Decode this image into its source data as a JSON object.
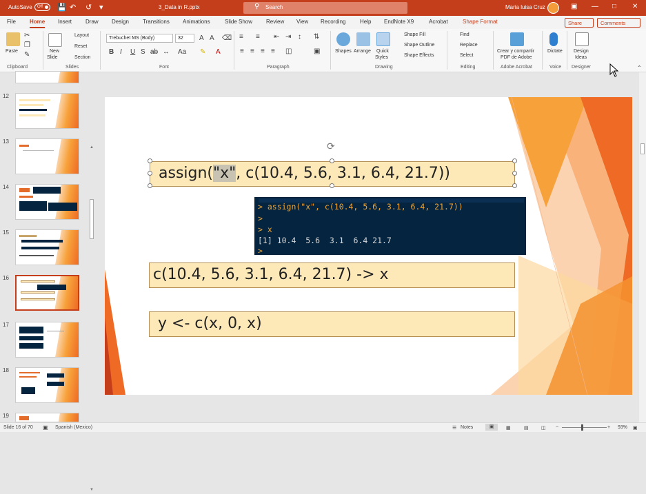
{
  "titlebar": {
    "autosave_label": "AutoSave",
    "autosave_state": "Off",
    "filename": "3_Data in R.pptx",
    "search_placeholder": "Search",
    "user_name": "Maria luisa Cruz"
  },
  "tabs": [
    "File",
    "Home",
    "Insert",
    "Draw",
    "Design",
    "Transitions",
    "Animations",
    "Slide Show",
    "Review",
    "View",
    "Recording",
    "Help",
    "EndNote X9",
    "Acrobat",
    "Shape Format"
  ],
  "active_tab": "Home",
  "share_label": "Share",
  "comments_label": "Comments",
  "ribbon": {
    "clipboard": {
      "paste": "Paste",
      "label": "Clipboard"
    },
    "slides": {
      "new_slide": "New",
      "new_slide2": "Slide",
      "layout": "Layout",
      "reset": "Reset",
      "section": "Section",
      "label": "Slides"
    },
    "font": {
      "font_name": "Trebuchet MS (Body)",
      "font_size": "32",
      "label": "Font"
    },
    "paragraph": {
      "label": "Paragraph"
    },
    "drawing": {
      "shapes": "Shapes",
      "arrange": "Arrange",
      "quick_styles": "Quick",
      "quick_styles2": "Styles",
      "shape_fill": "Shape Fill",
      "shape_outline": "Shape Outline",
      "shape_effects": "Shape Effects",
      "label": "Drawing"
    },
    "editing": {
      "find": "Find",
      "replace": "Replace",
      "select": "Select",
      "label": "Editing"
    },
    "acrobat": {
      "create": "Crear y compartir",
      "create2": "PDF de Adobe",
      "label": "Adobe Acrobat"
    },
    "voice": {
      "dictate": "Dictate",
      "label": "Voice"
    },
    "designer": {
      "design_ideas": "Design",
      "design_ideas2": "Ideas",
      "label": "Designer"
    }
  },
  "thumbnails": [
    {
      "num": "12"
    },
    {
      "num": "13"
    },
    {
      "num": "14"
    },
    {
      "num": "15"
    },
    {
      "num": "16"
    },
    {
      "num": "17"
    },
    {
      "num": "18"
    },
    {
      "num": "19"
    }
  ],
  "slide": {
    "box1_pre": "assign(",
    "box1_sel": "\"x\"",
    "box1_post": ", c(10.4, 5.6, 3.1, 6.4, 21.7))",
    "console_line1": "> assign(\"x\", c(10.4, 5.6, 3.1, 6.4, 21.7))",
    "console_line2": ">",
    "console_line3": "> x",
    "console_line4": "[1] 10.4  5.6  3.1  6.4 21.7",
    "console_line5": ">",
    "box2": "c(10.4, 5.6, 3.1, 6.4, 21.7) -> x",
    "box3": "y <- c(x, 0, x)"
  },
  "status": {
    "slide_of": "Slide 16 of 70",
    "language": "Spanish (Mexico)",
    "notes": "Notes",
    "zoom": "93%"
  },
  "colors": {
    "accent": "#c43e1c",
    "box_fill": "#fde9b8",
    "console_bg": "#042440"
  }
}
